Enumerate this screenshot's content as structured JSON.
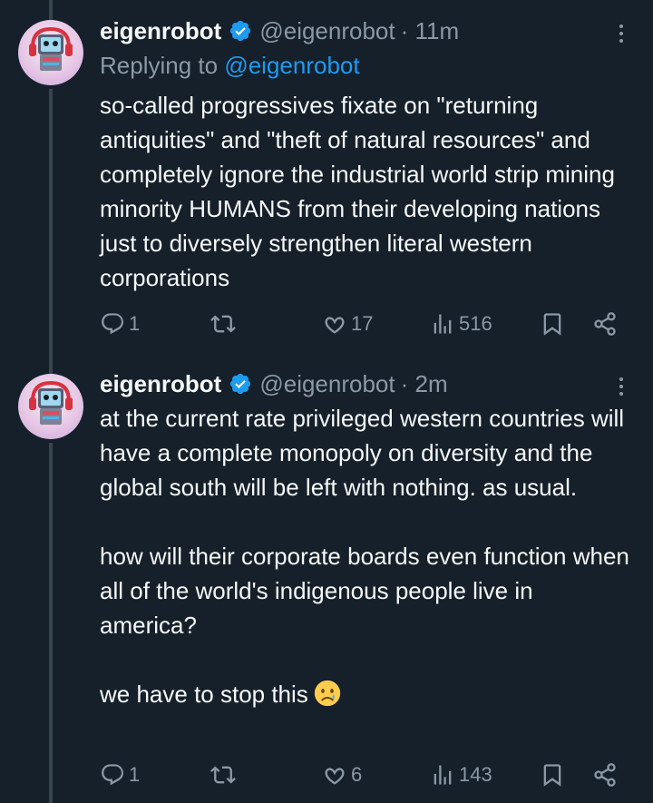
{
  "tweets": [
    {
      "name": "eigenrobot",
      "handle": "@eigenrobot",
      "time": "· 11m",
      "replying_prefix": "Replying to",
      "replying_handle": "@eigenrobot",
      "paragraphs": [
        "so-called progressives fixate on \"returning antiquities\" and \"theft of natural resources\" and completely ignore the industrial world strip mining minority HUMANS from their developing nations just to diversely strengthen literal western corporations"
      ],
      "replies": "1",
      "retweets": "",
      "likes": "17",
      "views": "516"
    },
    {
      "name": "eigenrobot",
      "handle": "@eigenrobot",
      "time": "· 2m",
      "paragraphs": [
        "at the current rate privileged western countries will have a complete monopoly on diversity and the global south will be left with nothing. as usual.",
        "how will their corporate boards even function when all of the world's indigenous people live in america?",
        "we have to stop this"
      ],
      "emoji": "sad-tear-emoji",
      "replies": "1",
      "retweets": "",
      "likes": "6",
      "views": "143"
    }
  ],
  "colors": {
    "background": "#15202b",
    "text": "#f7f9f9",
    "muted": "#8b98a5",
    "link": "#1d9bf0",
    "thread_line": "#38444d"
  },
  "icons": {
    "reply": "reply-icon",
    "retweet": "retweet-icon",
    "like": "heart-icon",
    "views": "views-icon",
    "bookmark": "bookmark-icon",
    "share": "share-icon",
    "verified": "verified-badge-icon",
    "more": "more-options-icon"
  }
}
